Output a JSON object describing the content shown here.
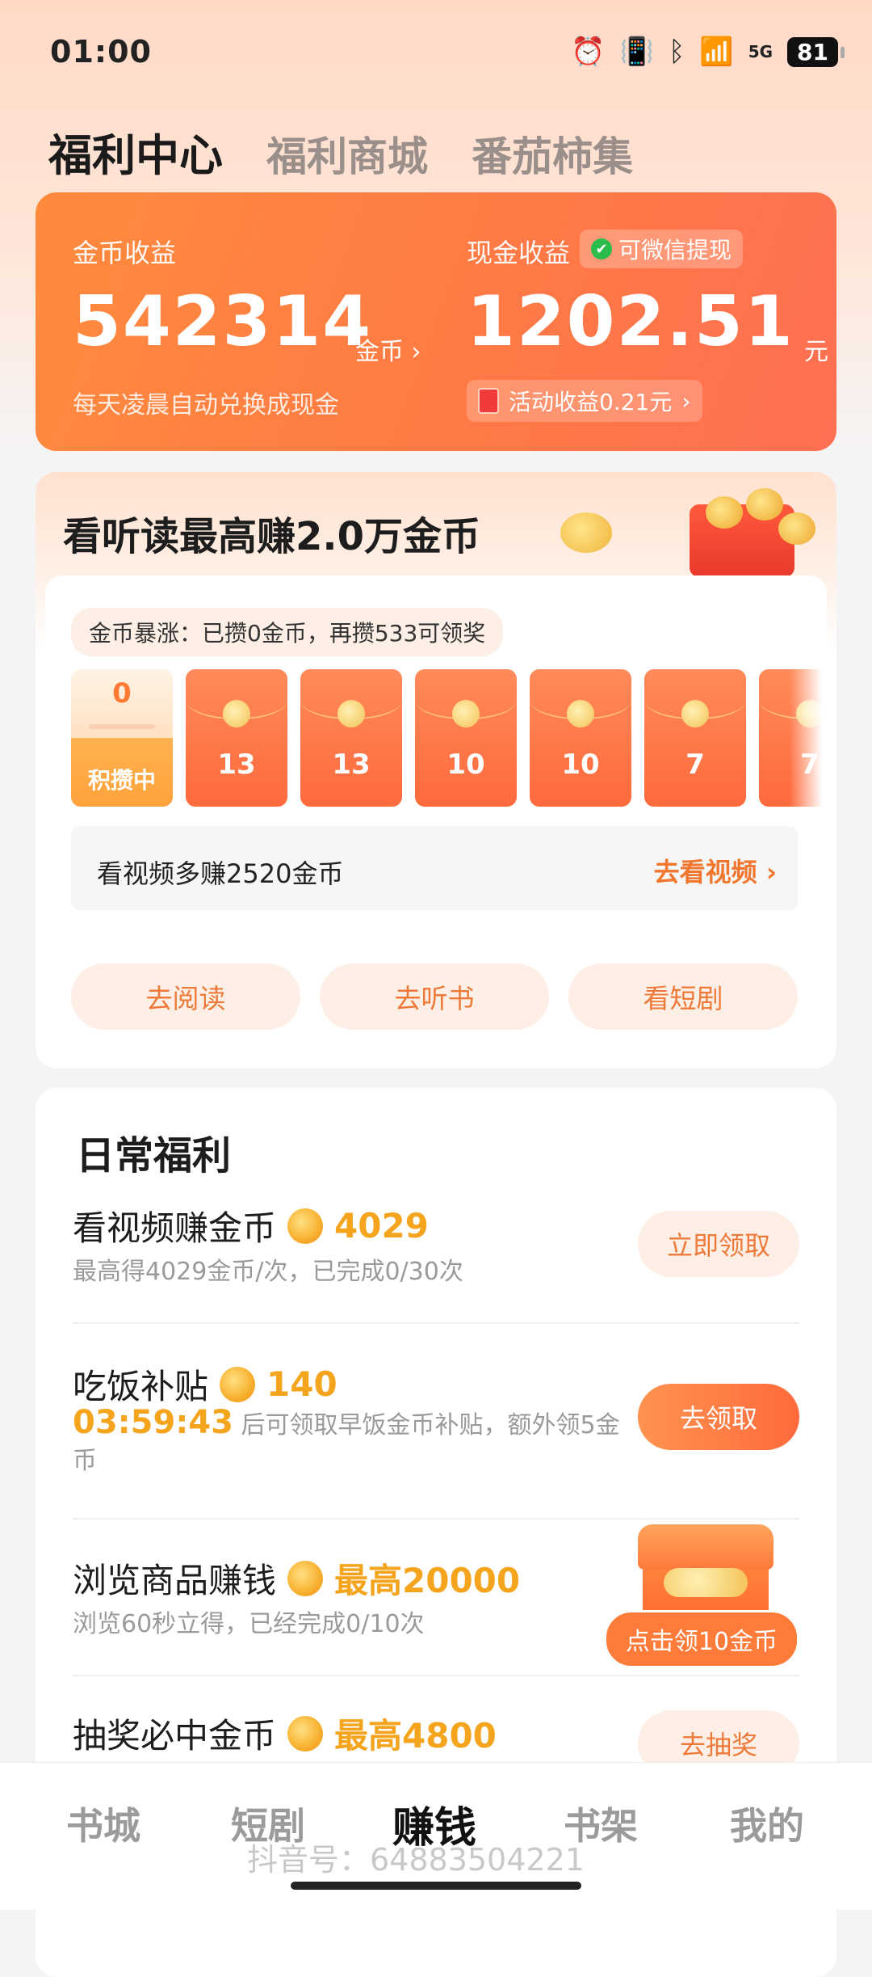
{
  "status_bar": {
    "time": "01:00",
    "battery": "81",
    "network": "5G"
  },
  "top_tabs": [
    "福利中心",
    "福利商城",
    "番茄柿集"
  ],
  "earnings": {
    "coin_label": "金币收益",
    "coin_value": "542314",
    "coin_unit": "金币",
    "coin_note": "每天凌晨自动兑换成现金",
    "cash_label": "现金收益",
    "wechat_badge": "可微信提现",
    "cash_value": "1202.51",
    "cash_unit": "元",
    "activity_earnings": "活动收益0.21元"
  },
  "reading_card": {
    "title": "看听读最高赚2.0万金币",
    "boost_text": "金币暴涨：已攒0金币，再攒533可领奖",
    "first_packet": {
      "value": "0",
      "label": "积攒中"
    },
    "packets": [
      "13",
      "13",
      "10",
      "10",
      "7",
      "7"
    ],
    "video_text": "看视频多赚2520金币",
    "video_action": "去看视频",
    "buttons": [
      "去阅读",
      "去听书",
      "看短剧"
    ]
  },
  "daily": {
    "title": "日常福利",
    "tasks": [
      {
        "title": "看视频赚金币",
        "reward": "4029",
        "sub": "最高得4029金币/次，已完成0/30次",
        "button": "立即领取"
      },
      {
        "title": "吃饭补贴",
        "reward": "140",
        "countdown": "03:59:43",
        "sub": "后可领取早饭金币补贴，额外领5金币",
        "button": "去领取"
      },
      {
        "title": "浏览商品赚钱",
        "reward": "最高20000",
        "sub": "浏览60秒立得，已经完成0/10次",
        "button": "点击领10金币"
      },
      {
        "title": "抽奖必中金币",
        "reward": "最高4800",
        "button": "去抽奖"
      }
    ]
  },
  "bottom_nav": [
    "书城",
    "短剧",
    "赚钱",
    "书架",
    "我的"
  ],
  "watermark": "抖音号：64883504221",
  "colors": {
    "accent": "#ff7a3a",
    "gold": "#f5a41e"
  }
}
